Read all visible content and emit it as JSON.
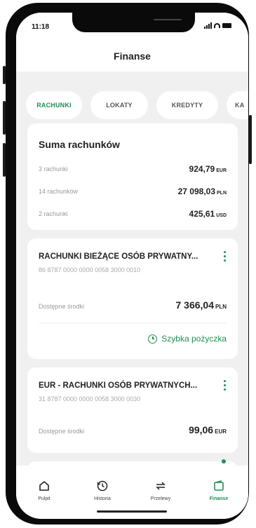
{
  "status": {
    "time": "11:18"
  },
  "header": {
    "title": "Finanse"
  },
  "tabs": [
    {
      "label": "RACHUNKI",
      "active": true
    },
    {
      "label": "LOKATY",
      "active": false
    },
    {
      "label": "KREDYTY",
      "active": false
    },
    {
      "label": "KA",
      "active": false
    }
  ],
  "summary": {
    "title": "Suma rachunków",
    "rows": [
      {
        "label": "3 rachunki",
        "amount": "924,79",
        "currency": "EUR"
      },
      {
        "label": "14 rachunków",
        "amount": "27 098,03",
        "currency": "PLN"
      },
      {
        "label": "2 rachunki",
        "amount": "425,61",
        "currency": "USD"
      }
    ]
  },
  "accounts": [
    {
      "title": "RACHUNKI BIEŻĄCE OSÓB PRYWATNY...",
      "number": "86 8787 0000 0000 0058 3000 0010",
      "balance_label": "Dostępne środki",
      "balance": "7 366,04",
      "currency": "PLN",
      "quick_loan": "Szybka pożyczka"
    },
    {
      "title": "EUR - RACHUNKI OSÓB PRYWATNYCH...",
      "number": "31 8787 0000 0000 0058 3000 0030",
      "balance_label": "Dostępne środki",
      "balance": "99,06",
      "currency": "EUR"
    }
  ],
  "nav": [
    {
      "label": "Pulpit",
      "icon": "home-icon"
    },
    {
      "label": "Historia",
      "icon": "history-icon"
    },
    {
      "label": "Przelewy",
      "icon": "transfer-icon"
    },
    {
      "label": "Finanse",
      "icon": "finance-icon",
      "active": true
    }
  ],
  "colors": {
    "accent": "#1f8f55",
    "background": "#f0f0f0"
  }
}
